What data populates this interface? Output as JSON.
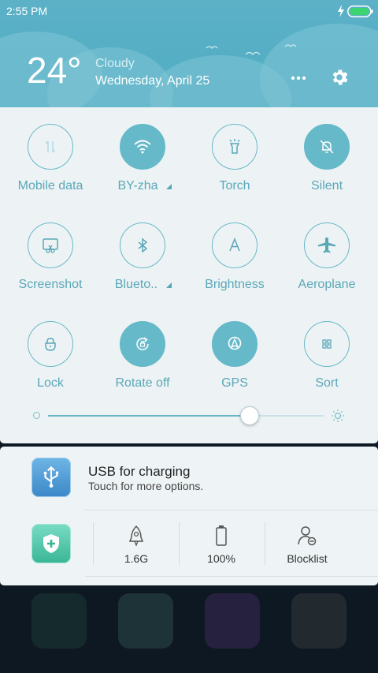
{
  "status_bar": {
    "time": "2:55 PM",
    "battery_color": "#3cd470"
  },
  "weather": {
    "temperature": "24°",
    "condition": "Cloudy",
    "date": "Wednesday, April 25"
  },
  "header_icons": [
    "more-icon",
    "gear-icon"
  ],
  "quick_settings": [
    {
      "label": "Mobile data",
      "icon": "mobile-data-icon",
      "state": "disabled"
    },
    {
      "label": "BY-zha",
      "icon": "wifi-icon",
      "state": "active",
      "expandable": true
    },
    {
      "label": "Torch",
      "icon": "torch-icon",
      "state": "inactive"
    },
    {
      "label": "Silent",
      "icon": "silent-bell-icon",
      "state": "active"
    },
    {
      "label": "Screenshot",
      "icon": "screenshot-icon",
      "state": "inactive"
    },
    {
      "label": "Blueto..",
      "icon": "bluetooth-icon",
      "state": "inactive",
      "expandable": true
    },
    {
      "label": "Brightness",
      "icon": "brightness-auto-icon",
      "state": "inactive"
    },
    {
      "label": "Aeroplane",
      "icon": "aeroplane-icon",
      "state": "inactive"
    },
    {
      "label": "Lock",
      "icon": "lock-icon",
      "state": "inactive"
    },
    {
      "label": "Rotate off",
      "icon": "rotate-icon",
      "state": "active"
    },
    {
      "label": "GPS",
      "icon": "gps-icon",
      "state": "active"
    },
    {
      "label": "Sort",
      "icon": "sort-grid-icon",
      "state": "inactive"
    }
  ],
  "brightness": {
    "level": 0.73
  },
  "notification": {
    "title": "USB for charging",
    "subtitle": "Touch for more options."
  },
  "tools": [
    {
      "label": "1.6G",
      "icon": "rocket-icon"
    },
    {
      "label": "100%",
      "icon": "battery-outline-icon"
    },
    {
      "label": "Blocklist",
      "icon": "blocklist-user-icon"
    }
  ],
  "colors": {
    "accent": "#66b9c9",
    "header": "#54aec4",
    "panel": "#edf3f4"
  }
}
